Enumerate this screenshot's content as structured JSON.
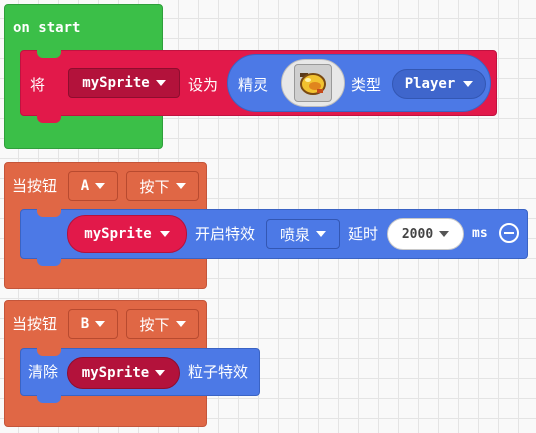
{
  "on_start": {
    "event_label": "on start",
    "set_prefix": "将",
    "sprite_var": "mySprite",
    "set_suffix": "设为",
    "sprite_label": "精灵",
    "kind_label": "类型",
    "kind_value": "Player"
  },
  "button_a": {
    "event_label": "当按钮",
    "button": "A",
    "action": "按下",
    "sprite_var": "mySprite",
    "effect_label": "开启特效",
    "effect": "喷泉",
    "delay_label": "延时",
    "delay_value": "2000",
    "unit": "ms"
  },
  "button_b": {
    "event_label": "当按钮",
    "button": "B",
    "action": "按下",
    "clear_label": "清除",
    "sprite_var": "mySprite",
    "particles_label": "粒子特效"
  },
  "colors": {
    "event_green": "#3bbf48",
    "sprite_red": "#e2194a",
    "event_orange": "#e06745",
    "effect_blue": "#4c79e6",
    "pill_blue": "#3f66cc",
    "dark_red": "#b3123b"
  },
  "icons": {
    "sprite_thumbnail": "lemon-sprite-icon",
    "collapse": "minus-circle-icon"
  }
}
